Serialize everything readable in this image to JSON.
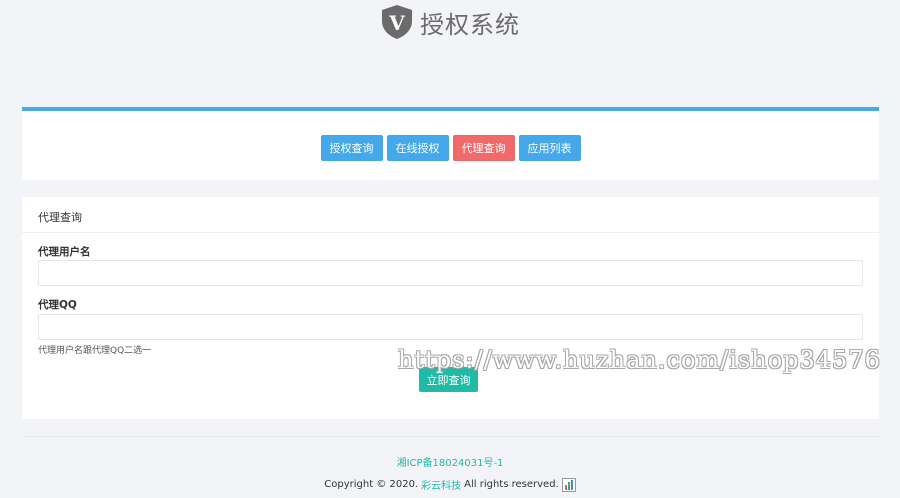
{
  "header": {
    "logo_letter": "V",
    "title": "授权系统"
  },
  "nav": {
    "buttons": [
      {
        "label": "授权查询",
        "color": "#45a8ea"
      },
      {
        "label": "在线授权",
        "color": "#45a8ea"
      },
      {
        "label": "代理查询",
        "color": "#f0696b"
      },
      {
        "label": "应用列表",
        "color": "#45a8ea"
      }
    ]
  },
  "form": {
    "title": "代理查询",
    "username_label": "代理用户名",
    "username_value": "",
    "qq_label": "代理QQ",
    "qq_value": "",
    "hint": "代理用户名跟代理QQ二选一",
    "submit_label": "立即查询"
  },
  "watermark": "https://www.huzhan.com/ishop34576",
  "footer": {
    "icp": "湘ICP备18024031号-1",
    "copyright_prefix": "Copyright © 2020.",
    "brand": "彩云科技",
    "copyright_suffix": "All rights reserved."
  },
  "colors": {
    "accent_blue": "#4aa8ec",
    "accent_red": "#f0696b",
    "accent_teal": "#1fbba6"
  }
}
